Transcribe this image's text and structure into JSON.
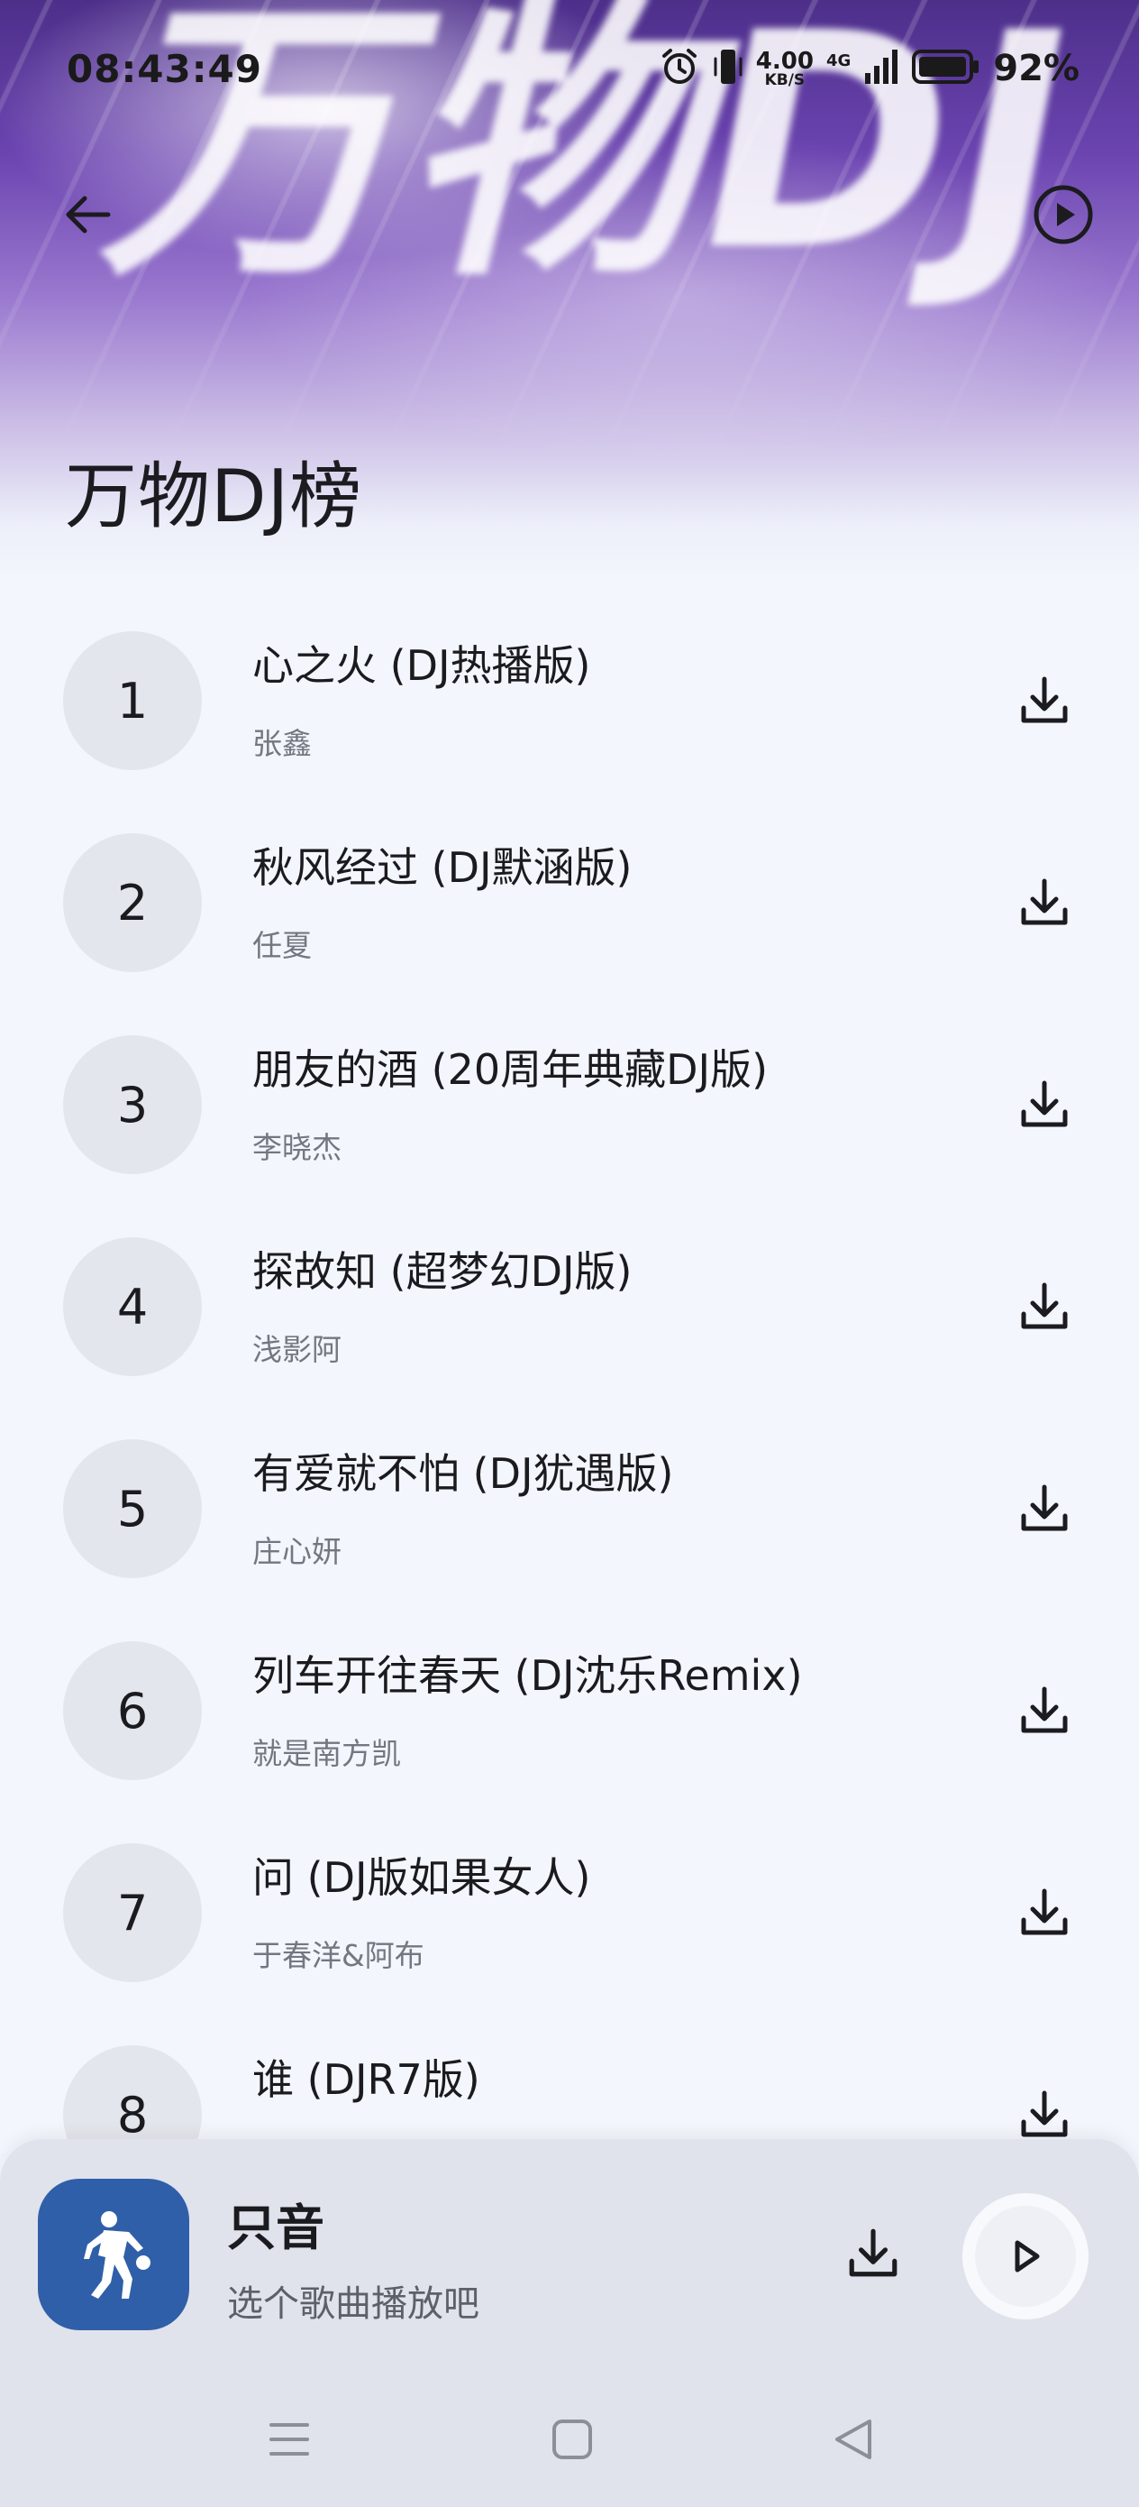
{
  "status_bar": {
    "time": "08:43:49",
    "net_speed_value": "4.00",
    "net_speed_unit": "KB/S",
    "network_type": "4G",
    "battery": "92%",
    "icons": [
      "alarm-icon",
      "vibrate-icon",
      "signal-icon",
      "battery-icon"
    ]
  },
  "header": {
    "banner_text": "万物DJ",
    "title": "万物DJ榜",
    "back_icon": "arrow-left-icon",
    "play_all_icon": "play-circle-icon"
  },
  "songs": [
    {
      "rank": "1",
      "title": "心之火 (DJ热播版)",
      "artist": "张鑫"
    },
    {
      "rank": "2",
      "title": "秋风经过 (DJ默涵版)",
      "artist": "任夏"
    },
    {
      "rank": "3",
      "title": "朋友的酒 (20周年典藏DJ版)",
      "artist": "李晓杰"
    },
    {
      "rank": "4",
      "title": "探故知 (超梦幻DJ版)",
      "artist": "浅影阿"
    },
    {
      "rank": "5",
      "title": "有爱就不怕 (DJ犹遇版)",
      "artist": "庄心妍"
    },
    {
      "rank": "6",
      "title": "列车开往春天 (DJ沈乐Remix)",
      "artist": "就是南方凯"
    },
    {
      "rank": "7",
      "title": "问 (DJ版如果女人)",
      "artist": "于春洋&阿布"
    },
    {
      "rank": "8",
      "title": "谁 (DJR7版)",
      "artist": ""
    }
  ],
  "player": {
    "title": "只音",
    "subtitle": "选个歌曲播放吧",
    "accent_color": "#2f5fa8"
  },
  "system_nav": {
    "icons": [
      "menu-icon",
      "home-square-icon",
      "back-triangle-icon"
    ]
  }
}
